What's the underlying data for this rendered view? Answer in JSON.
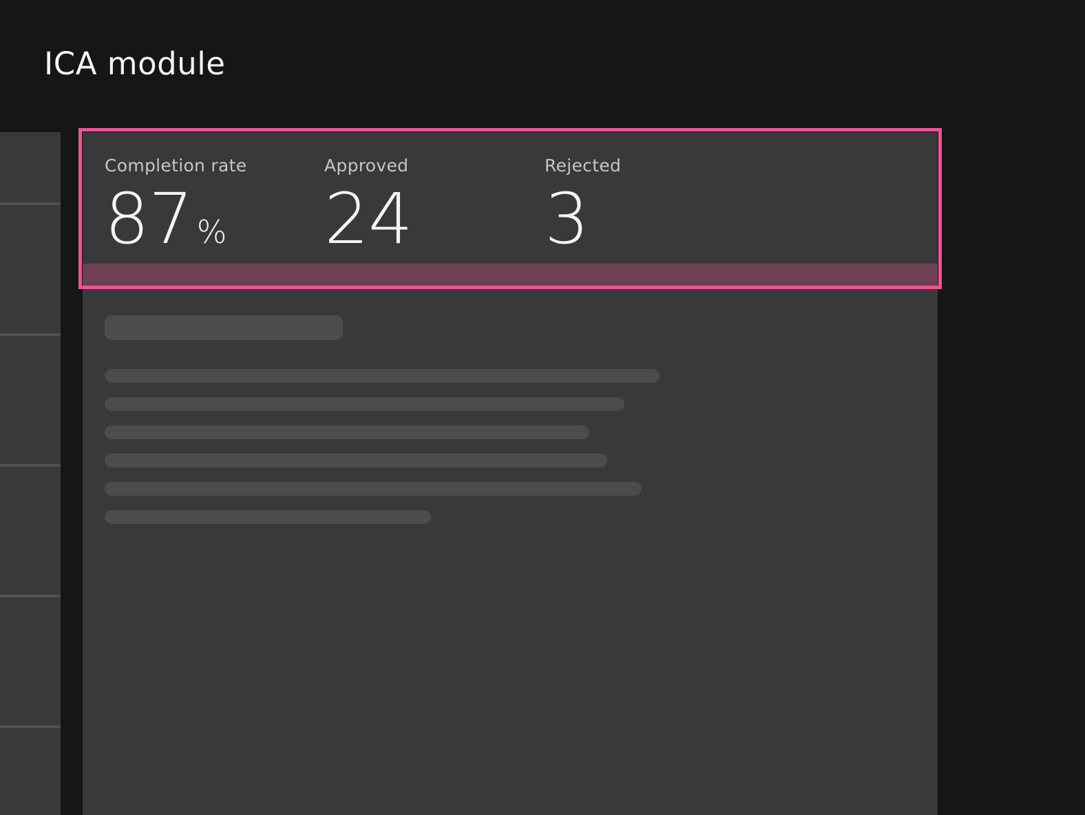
{
  "page": {
    "title": "ICA module"
  },
  "kpis": [
    {
      "label": "Completion rate",
      "value": "87",
      "unit": "%"
    },
    {
      "label": "Approved",
      "value": "24",
      "unit": ""
    },
    {
      "label": "Rejected",
      "value": "3",
      "unit": ""
    }
  ],
  "colors": {
    "background": "#161616",
    "card": "#393939",
    "skeleton": "#4c4c4c",
    "highlight_border": "#ee5396",
    "highlight_band": "#6f4055",
    "text_primary": "#f4f4f4",
    "text_secondary": "#c6c6c6"
  }
}
